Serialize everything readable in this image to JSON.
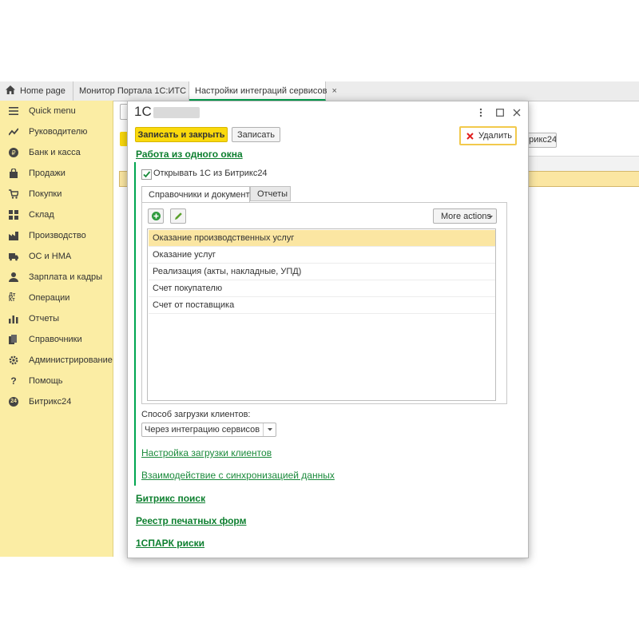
{
  "tabs": [
    {
      "label": "Home page"
    },
    {
      "label": "Монитор Портала 1С:ИТС",
      "close": "×"
    },
    {
      "label": "Настройки интеграций сервисов",
      "close": "×"
    }
  ],
  "sidebar": {
    "items": [
      {
        "label": "Quick menu",
        "icon": "menu-icon"
      },
      {
        "label": "Руководителю",
        "icon": "chart-trend-icon"
      },
      {
        "label": "Банк и касса",
        "icon": "ruble-icon"
      },
      {
        "label": "Продажи",
        "icon": "bag-icon"
      },
      {
        "label": "Покупки",
        "icon": "cart-icon"
      },
      {
        "label": "Склад",
        "icon": "grid-icon"
      },
      {
        "label": "Производство",
        "icon": "factory-icon"
      },
      {
        "label": "ОС и НМА",
        "icon": "truck-icon"
      },
      {
        "label": "Зарплата и кадры",
        "icon": "person-icon"
      },
      {
        "label": "Операции",
        "icon": "ledger-icon",
        "glyph": "Дт Кт"
      },
      {
        "label": "Отчеты",
        "icon": "bar-chart-icon"
      },
      {
        "label": "Справочники",
        "icon": "books-icon"
      },
      {
        "label": "Администрирование",
        "icon": "gear-icon"
      },
      {
        "label": "Помощь",
        "icon": "help-icon",
        "glyph": "?"
      },
      {
        "label": "Битрикс24",
        "icon": "bitrix24-icon",
        "glyph": "24"
      }
    ]
  },
  "background": {
    "button_fragment": "итрикс24"
  },
  "dialog": {
    "title": "1С",
    "header_icons": {
      "more": "more-vert-icon",
      "maximize": "maximize-icon",
      "close": "close-icon"
    },
    "toolbar": {
      "save_close": "Записать и закрыть",
      "save": "Записать",
      "delete": "Удалить"
    },
    "sections": {
      "single_window": "Работа из одного окна",
      "bitrix_search": "Битрикс поиск",
      "print_forms": "Реестр печатных форм",
      "spark_risks": "1СПАРК риски"
    },
    "open_from_bitrix": {
      "checked": true,
      "label": "Открывать 1С из Битрикс24"
    },
    "inner_tabs": [
      "Справочники и документы",
      "Отчеты"
    ],
    "list_toolbar": {
      "more_actions": "More actions"
    },
    "list_items": [
      "Оказание производственных услуг",
      "Оказание услуг",
      "Реализация (акты, накладные, УПД)",
      "Счет покупателю",
      "Счет от поставщика"
    ],
    "client_loading": {
      "label": "Способ загрузки клиентов:",
      "value": "Через интеграцию сервисов"
    },
    "links": {
      "client_loading_settings": "Настройка загрузки клиентов",
      "sync_interaction": "Взаимодействие с синхронизацией данных"
    }
  },
  "colors": {
    "sidebar_bg": "#fbeda4",
    "primary_button": "#fad90c",
    "selected_row": "#fbe6a2",
    "accent_green": "#0d7f2f",
    "delete_red": "#e02020"
  }
}
